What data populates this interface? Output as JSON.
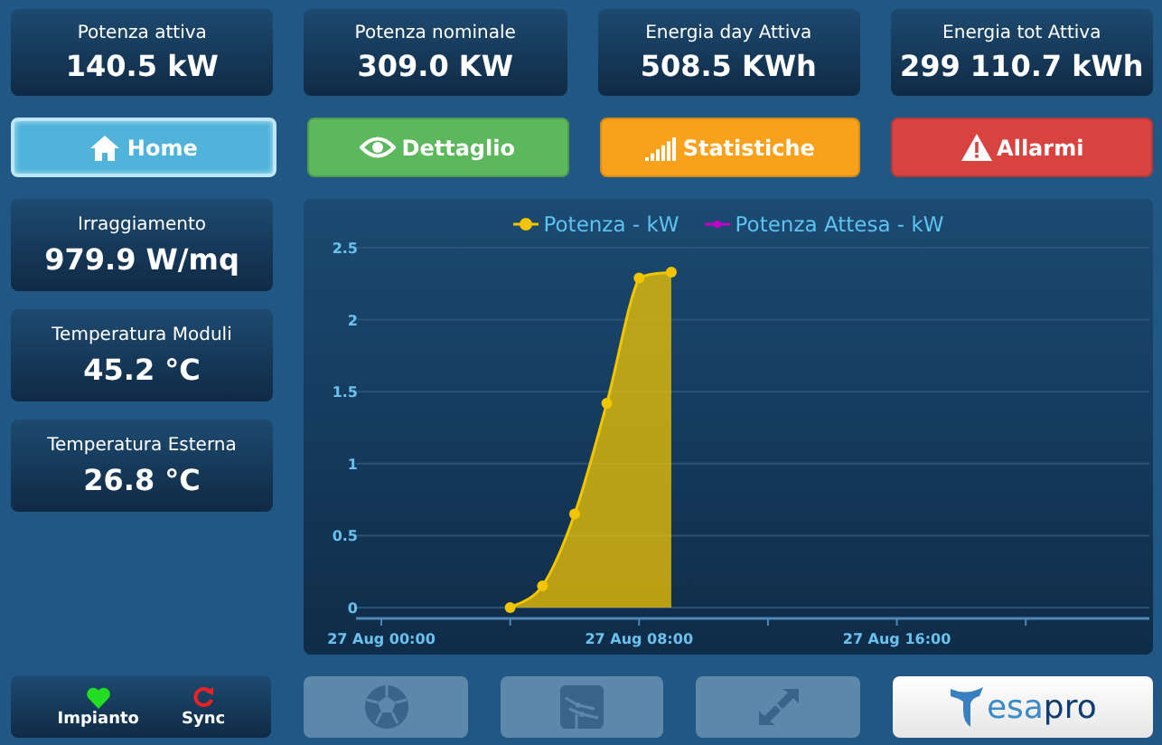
{
  "metrics": [
    {
      "label": "Potenza attiva",
      "value": "140.5 kW"
    },
    {
      "label": "Potenza nominale",
      "value": "309.0 KW"
    },
    {
      "label": "Energia day Attiva",
      "value": "508.5 KWh"
    },
    {
      "label": "Energia tot Attiva",
      "value": "299 110.7 kWh"
    }
  ],
  "nav": [
    {
      "label": "Home",
      "kind": "home",
      "color": "#4fb3da",
      "selected": true
    },
    {
      "label": "Dettaglio",
      "kind": "eye",
      "color": "#5cb85c",
      "selected": false
    },
    {
      "label": "Statistiche",
      "kind": "bars",
      "color": "#f9a11b",
      "selected": false
    },
    {
      "label": "Allarmi",
      "kind": "warning",
      "color": "#d9433f",
      "selected": false
    }
  ],
  "sensors": [
    {
      "label": "Irraggiamento",
      "value": "979.9 W/mq"
    },
    {
      "label": "Temperatura Moduli",
      "value": "45.2 °C"
    },
    {
      "label": "Temperatura Esterna",
      "value": "26.8 °C"
    }
  ],
  "chart": {
    "chart_data": {
      "type": "area",
      "grid": true,
      "ylim": [
        0,
        2.5
      ],
      "categories": [
        "27 Aug 00:00",
        null,
        null,
        null,
        null,
        null,
        null,
        null,
        "27 Aug 08:00",
        null,
        null,
        null,
        null,
        null,
        null,
        null,
        "27 Aug 16:00",
        null,
        null,
        null,
        null,
        null,
        null,
        null
      ],
      "yticks": [
        0,
        0.5,
        1,
        1.5,
        2,
        2.5
      ],
      "series": [
        {
          "name": "Potenza - kW",
          "color": "#f2c500",
          "values": [
            null,
            null,
            null,
            null,
            0,
            0.15,
            0.65,
            1.42,
            2.29,
            2.33,
            null,
            null,
            null,
            null,
            null,
            null,
            null,
            null,
            null,
            null,
            null,
            null,
            null,
            null
          ]
        },
        {
          "name": "Potenza Attesa - kW",
          "color": "#c400c4",
          "values": [
            null,
            null,
            null,
            null,
            null,
            null,
            null,
            null,
            null,
            null,
            null,
            null,
            null,
            null,
            null,
            null,
            null,
            null,
            null,
            null,
            null,
            null,
            null,
            null
          ]
        }
      ]
    }
  },
  "status": [
    {
      "label": "Impianto",
      "kind": "heart",
      "color": "#22dd22"
    },
    {
      "label": "Sync",
      "kind": "sync",
      "color": "#ee2222"
    }
  ],
  "tools": [
    {
      "kind": "ball",
      "disabled": true
    },
    {
      "kind": "circuit",
      "disabled": true
    },
    {
      "kind": "arrows",
      "disabled": true
    }
  ],
  "logo": {
    "text": "esa**pro**"
  }
}
